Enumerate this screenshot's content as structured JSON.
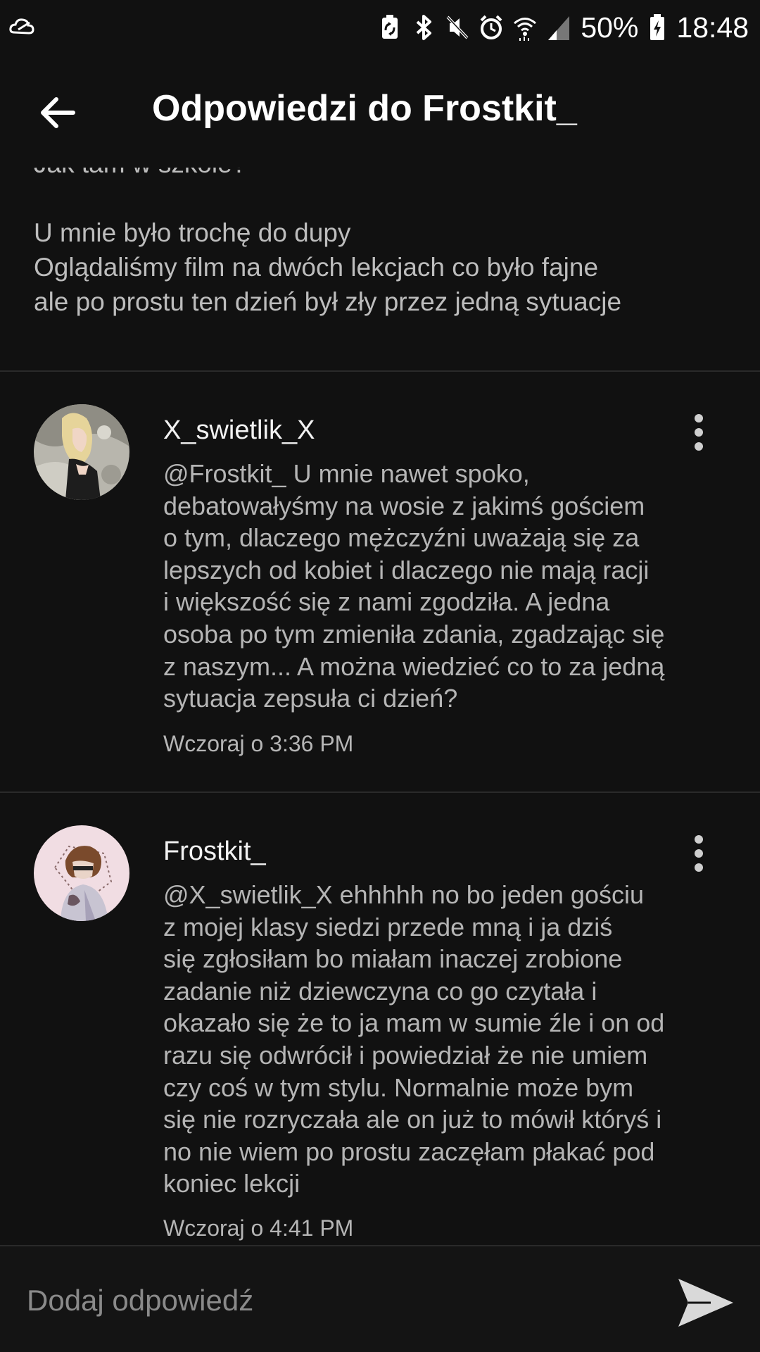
{
  "status_bar": {
    "battery_percent": "50%",
    "time": "18:48",
    "icons": [
      "cloud-icon",
      "battery-saver-icon",
      "bluetooth-icon",
      "mute-icon",
      "alarm-icon",
      "wifi-icon",
      "signal-icon",
      "battery-icon"
    ]
  },
  "app_bar": {
    "title": "Odpowiedzi do Frostkit_",
    "back_icon": "arrow-back-icon"
  },
  "post": {
    "lines": [
      "Jak tam w szkole?",
      "",
      "U mnie było trochę do dupy",
      "Oglądaliśmy film na dwóch lekcjach co było fajne",
      "ale po prostu ten dzień był zły przez jedną sytuacje"
    ]
  },
  "comments": [
    {
      "username": "X_swietlik_X",
      "body_lines": [
        "@Frostkit_  U mnie nawet spoko,",
        "debatowałyśmy na wosie z jakimś gościem",
        "o tym, dlaczego mężczyźni uważają się za",
        "lepszych od kobiet i dlaczego nie mają racji",
        "i większość się z nami zgodziła. A jedna",
        "osoba po tym zmieniła zdania, zgadzając się",
        "z naszym... A można wiedzieć co to za jedną",
        "sytuacja zepsuła ci dzień?"
      ],
      "timestamp": "Wczoraj o 3:36 PM"
    },
    {
      "username": "Frostkit_",
      "body_lines": [
        "@X_swietlik_X  ehhhhh no bo jeden gościu",
        "z mojej klasy siedzi przede mną i ja dziś",
        "się zgłosiłam bo miałam inaczej zrobione",
        "zadanie niż dziewczyna co go czytała i",
        "okazało się że to ja mam w sumie źle i on od",
        "razu się odwrócił i powiedział że nie umiem",
        "czy coś w tym stylu. Normalnie może bym",
        "się nie rozryczała ale on już to mówił któryś i",
        "no nie wiem po prostu zaczęłam płakać pod",
        "koniec lekcji"
      ],
      "timestamp": "Wczoraj o 4:41 PM"
    }
  ],
  "reply_bar": {
    "placeholder": "Dodaj odpowiedź",
    "send_icon": "send-icon"
  },
  "colors": {
    "background": "#111111",
    "text_primary": "#ffffff",
    "text_secondary": "#b5b5b5",
    "divider": "#2a2a2a"
  }
}
